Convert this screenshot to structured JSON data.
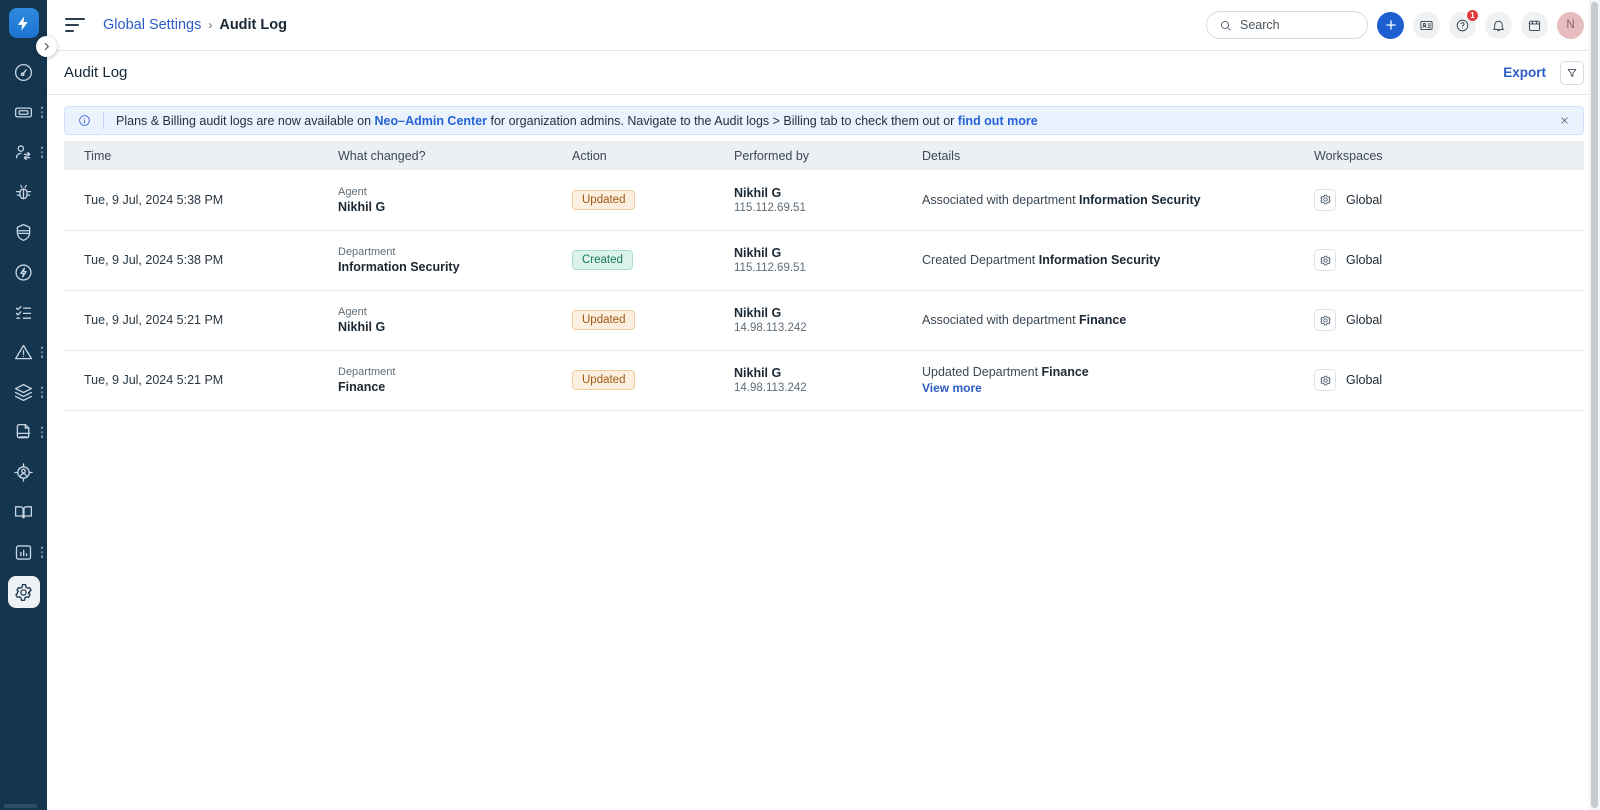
{
  "sidebar": {
    "logo_icon": "lightning-bolt-logo",
    "items": [
      {
        "icon": "dashboard-gauge-icon",
        "name": "dashboard",
        "has_menu": false,
        "active": false
      },
      {
        "icon": "ticket-icon",
        "name": "tickets",
        "has_menu": true,
        "active": false
      },
      {
        "icon": "contacts-switch-icon",
        "name": "contacts",
        "has_menu": true,
        "active": false
      },
      {
        "icon": "bug-icon",
        "name": "problems",
        "has_menu": false,
        "active": false
      },
      {
        "icon": "shield-icon",
        "name": "security",
        "has_menu": false,
        "active": false
      },
      {
        "icon": "bolt-circle-icon",
        "name": "automations",
        "has_menu": false,
        "active": false
      },
      {
        "icon": "checklist-icon",
        "name": "tasks",
        "has_menu": false,
        "active": false
      },
      {
        "icon": "alert-triangle-icon",
        "name": "incidents",
        "has_menu": true,
        "active": false
      },
      {
        "icon": "layers-stack-icon",
        "name": "assets",
        "has_menu": true,
        "active": false
      },
      {
        "icon": "document-scan-icon",
        "name": "contracts",
        "has_menu": true,
        "active": false
      },
      {
        "icon": "user-target-icon",
        "name": "onboarding",
        "has_menu": false,
        "active": false
      },
      {
        "icon": "book-open-icon",
        "name": "solutions",
        "has_menu": false,
        "active": false
      },
      {
        "icon": "bar-chart-icon",
        "name": "analytics",
        "has_menu": true,
        "active": false
      },
      {
        "icon": "gear-icon",
        "name": "admin-settings",
        "has_menu": false,
        "active": true
      }
    ],
    "collapse_icon": "chevron-right-icon"
  },
  "topbar": {
    "menu_icon": "hamburger-menu-icon",
    "breadcrumb": {
      "parent": "Global Settings",
      "separator": "›",
      "current": "Audit Log"
    },
    "search": {
      "placeholder": "Search",
      "value": "",
      "icon": "search-icon"
    },
    "actions": [
      {
        "name": "new-item-button",
        "icon": "plus-icon",
        "style": "blue"
      },
      {
        "name": "contacts-button",
        "icon": "id-card-icon",
        "style": "grey"
      },
      {
        "name": "help-button",
        "icon": "question-circle-icon",
        "style": "grey",
        "badge": "1"
      },
      {
        "name": "notifications-button",
        "icon": "bell-icon",
        "style": "grey"
      },
      {
        "name": "marketplace-button",
        "icon": "store-icon",
        "style": "grey"
      }
    ],
    "avatar": {
      "initial": "N",
      "color": "#e6bcbe"
    }
  },
  "page": {
    "title": "Audit Log",
    "export_label": "Export",
    "filter_icon": "filter-funnel-icon"
  },
  "banner": {
    "info_icon": "info-circle-icon",
    "close_icon": "close-icon",
    "text_1": "Plans & Billing audit logs are now available on ",
    "highlight": "Neo–Admin Center",
    "text_2": " for organization admins. Navigate to the Audit logs > Billing tab to check them out or ",
    "link": "find out more"
  },
  "table": {
    "columns": [
      "Time",
      "What changed?",
      "Action",
      "Performed by",
      "Details",
      "Workspaces"
    ],
    "rows": [
      {
        "time": "Tue, 9 Jul, 2024 5:38 PM",
        "what_type": "Agent",
        "what_name": "Nikhil G",
        "action": "Updated",
        "action_style": "updated",
        "performed_by": "Nikhil G",
        "ip": "115.112.69.51",
        "details_prefix": "Associated with department ",
        "details_strong": "Information Security",
        "view_more": "",
        "workspace": "Global",
        "workspace_icon": "gear-icon"
      },
      {
        "time": "Tue, 9 Jul, 2024 5:38 PM",
        "what_type": "Department",
        "what_name": "Information Security",
        "action": "Created",
        "action_style": "created",
        "performed_by": "Nikhil G",
        "ip": "115.112.69.51",
        "details_prefix": "Created Department ",
        "details_strong": "Information Security",
        "view_more": "",
        "workspace": "Global",
        "workspace_icon": "gear-icon"
      },
      {
        "time": "Tue, 9 Jul, 2024 5:21 PM",
        "what_type": "Agent",
        "what_name": "Nikhil G",
        "action": "Updated",
        "action_style": "updated",
        "performed_by": "Nikhil G",
        "ip": "14.98.113.242",
        "details_prefix": "Associated with department ",
        "details_strong": "Finance",
        "view_more": "",
        "workspace": "Global",
        "workspace_icon": "gear-icon"
      },
      {
        "time": "Tue, 9 Jul, 2024 5:21 PM",
        "what_type": "Department",
        "what_name": "Finance",
        "action": "Updated",
        "action_style": "updated",
        "performed_by": "Nikhil G",
        "ip": "14.98.113.242",
        "details_prefix": "Updated Department ",
        "details_strong": "Finance",
        "view_more": "View more",
        "workspace": "Global",
        "workspace_icon": "gear-icon"
      }
    ]
  },
  "colors": {
    "sidebar_bg": "#13354f",
    "accent_blue": "#2c5cc5",
    "primary_blue": "#1d5ed1",
    "banner_bg": "#eaf2fe",
    "pill_updated_bg": "#fdefdf",
    "pill_created_bg": "#ddf3ea",
    "badge_red": "#e23b3b"
  }
}
